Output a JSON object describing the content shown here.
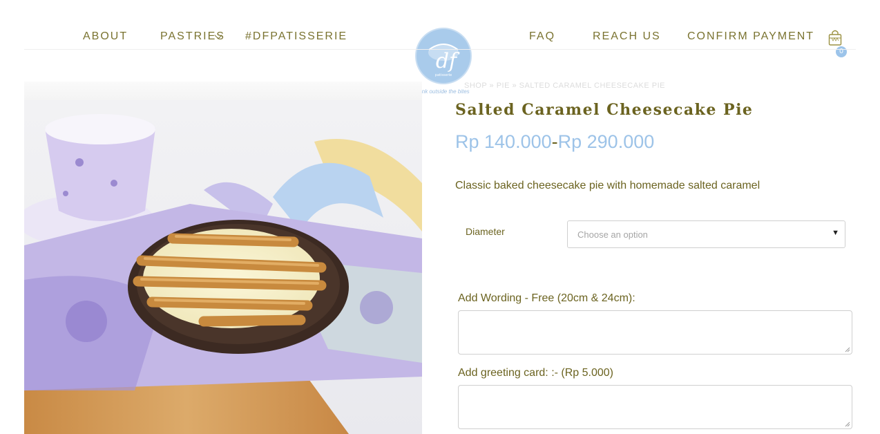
{
  "nav": {
    "left": [
      "ABOUT",
      "PASTRIES",
      "#DFPATISSERIE"
    ],
    "right": [
      "FAQ",
      "REACH US",
      "CONFIRM PAYMENT"
    ]
  },
  "logo": {
    "text": "df",
    "small": "patisserie",
    "tagline": "think outside the bites"
  },
  "cart": {
    "count": "0",
    "icon": "shopping-bag-icon"
  },
  "breadcrumb": "SHOP » PIE » SALTED CARAMEL CHEESECAKE PIE",
  "product": {
    "title": "Salted Caramel Cheesecake Pie",
    "price_min": "Rp 140.000",
    "price_sep": "-",
    "price_max": "Rp 290.000",
    "description": "Classic baked cheesecake pie with homemade salted caramel"
  },
  "options": {
    "diameter_label": "Diameter",
    "diameter_placeholder": "Choose an option"
  },
  "addons": {
    "wording_label": "Add Wording - Free (20cm & 24cm):",
    "card_label": "Add greeting card: :- (Rp 5.000)"
  },
  "colors": {
    "accent": "#9dc3e8",
    "text": "#6b6320",
    "nav": "#7a7330"
  }
}
